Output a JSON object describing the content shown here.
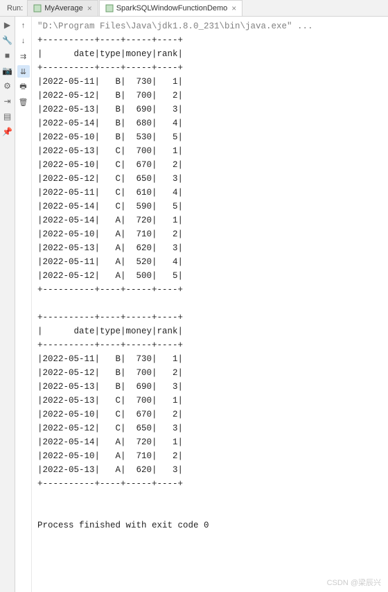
{
  "run_label": "Run:",
  "tabs": [
    {
      "label": "MyAverage",
      "active": false
    },
    {
      "label": "SparkSQLWindowFunctionDemo",
      "active": true
    }
  ],
  "command": "\"D:\\Program Files\\Java\\jdk1.8.0_231\\bin\\java.exe\" ...",
  "divider": "+----------+----+-----+----+",
  "header": "|      date|type|money|rank|",
  "table1_rows": [
    "|2022-05-11|   B|  730|   1|",
    "|2022-05-12|   B|  700|   2|",
    "|2022-05-13|   B|  690|   3|",
    "|2022-05-14|   B|  680|   4|",
    "|2022-05-10|   B|  530|   5|",
    "|2022-05-13|   C|  700|   1|",
    "|2022-05-10|   C|  670|   2|",
    "|2022-05-12|   C|  650|   3|",
    "|2022-05-11|   C|  610|   4|",
    "|2022-05-14|   C|  590|   5|",
    "|2022-05-14|   A|  720|   1|",
    "|2022-05-10|   A|  710|   2|",
    "|2022-05-13|   A|  620|   3|",
    "|2022-05-11|   A|  520|   4|",
    "|2022-05-12|   A|  500|   5|"
  ],
  "table2_rows": [
    "|2022-05-11|   B|  730|   1|",
    "|2022-05-12|   B|  700|   2|",
    "|2022-05-13|   B|  690|   3|",
    "|2022-05-13|   C|  700|   1|",
    "|2022-05-10|   C|  670|   2|",
    "|2022-05-12|   C|  650|   3|",
    "|2022-05-14|   A|  720|   1|",
    "|2022-05-10|   A|  710|   2|",
    "|2022-05-13|   A|  620|   3|"
  ],
  "exit_message": "Process finished with exit code 0",
  "watermark": "CSDN @梁辰兴",
  "chart_data": {
    "type": "table",
    "tables": [
      {
        "columns": [
          "date",
          "type",
          "money",
          "rank"
        ],
        "rows": [
          [
            "2022-05-11",
            "B",
            730,
            1
          ],
          [
            "2022-05-12",
            "B",
            700,
            2
          ],
          [
            "2022-05-13",
            "B",
            690,
            3
          ],
          [
            "2022-05-14",
            "B",
            680,
            4
          ],
          [
            "2022-05-10",
            "B",
            530,
            5
          ],
          [
            "2022-05-13",
            "C",
            700,
            1
          ],
          [
            "2022-05-10",
            "C",
            670,
            2
          ],
          [
            "2022-05-12",
            "C",
            650,
            3
          ],
          [
            "2022-05-11",
            "C",
            610,
            4
          ],
          [
            "2022-05-14",
            "C",
            590,
            5
          ],
          [
            "2022-05-14",
            "A",
            720,
            1
          ],
          [
            "2022-05-10",
            "A",
            710,
            2
          ],
          [
            "2022-05-13",
            "A",
            620,
            3
          ],
          [
            "2022-05-11",
            "A",
            520,
            4
          ],
          [
            "2022-05-12",
            "A",
            500,
            5
          ]
        ]
      },
      {
        "columns": [
          "date",
          "type",
          "money",
          "rank"
        ],
        "rows": [
          [
            "2022-05-11",
            "B",
            730,
            1
          ],
          [
            "2022-05-12",
            "B",
            700,
            2
          ],
          [
            "2022-05-13",
            "B",
            690,
            3
          ],
          [
            "2022-05-13",
            "C",
            700,
            1
          ],
          [
            "2022-05-10",
            "C",
            670,
            2
          ],
          [
            "2022-05-12",
            "C",
            650,
            3
          ],
          [
            "2022-05-14",
            "A",
            720,
            1
          ],
          [
            "2022-05-10",
            "A",
            710,
            2
          ],
          [
            "2022-05-13",
            "A",
            620,
            3
          ]
        ]
      }
    ]
  }
}
